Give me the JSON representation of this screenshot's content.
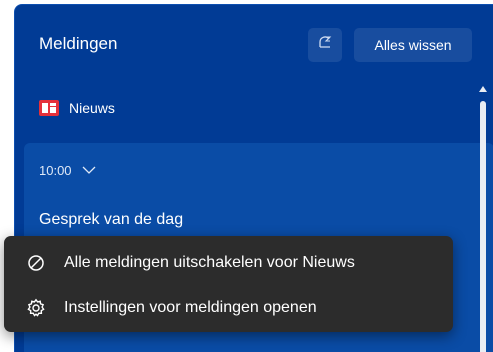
{
  "header": {
    "title": "Meldingen",
    "focus_icon": "focus-assist-icon",
    "clear_all_label": "Alles wissen"
  },
  "app_group": {
    "icon": "news-icon",
    "name": "Nieuws"
  },
  "notification": {
    "time": "10:00",
    "headline": "Gesprek van de dag"
  },
  "context_menu": {
    "items": [
      {
        "icon": "block-icon",
        "label": "Alle meldingen uitschakelen voor Nieuws"
      },
      {
        "icon": "gear-icon",
        "label": "Instellingen voor meldingen openen"
      }
    ]
  },
  "colors": {
    "panel_bg": "#013b95",
    "button_bg": "#184d9f",
    "card_bg": "#0a4ca6",
    "menu_bg": "#2c2c2c",
    "news_red": "#e5303a"
  }
}
